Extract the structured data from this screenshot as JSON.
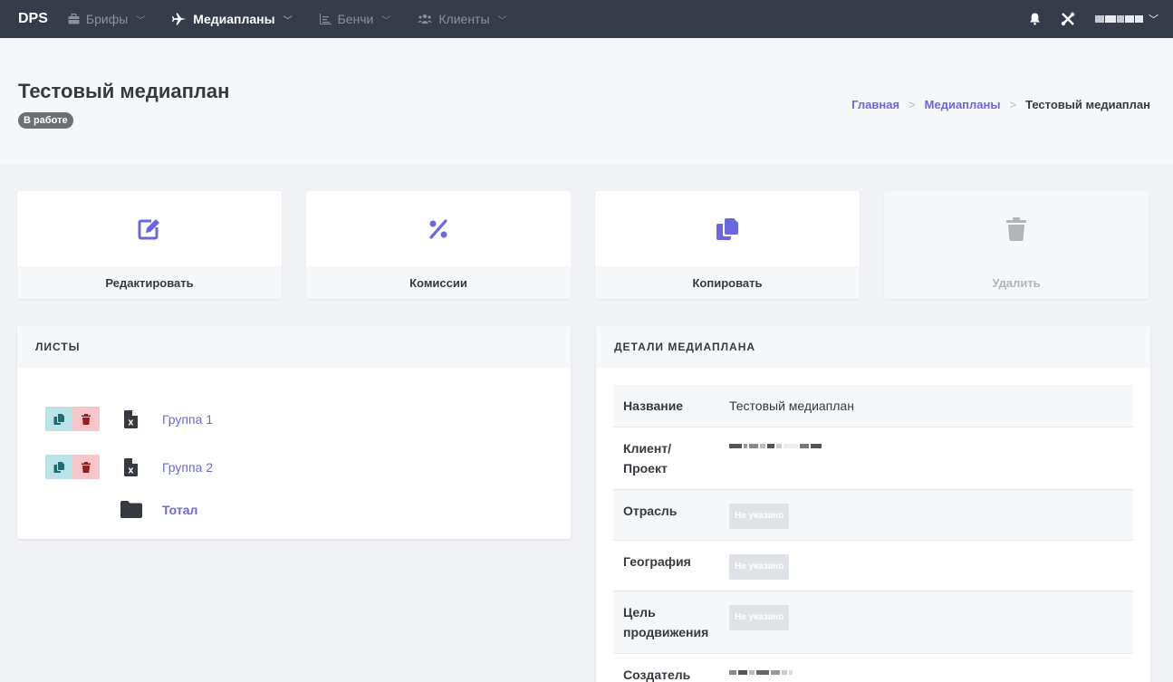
{
  "nav": {
    "brand": "DPS",
    "items": [
      {
        "label": "Брифы",
        "icon": "briefcase-icon",
        "active": false
      },
      {
        "label": "Медиапланы",
        "icon": "plane-icon",
        "active": true
      },
      {
        "label": "Бенчи",
        "icon": "chart-icon",
        "active": false
      },
      {
        "label": "Клиенты",
        "icon": "users-icon",
        "active": false
      }
    ]
  },
  "header": {
    "title": "Тестовый медиаплан",
    "status": "В работе",
    "breadcrumb": {
      "home": "Главная",
      "section": "Медиапланы",
      "current": "Тестовый медиаплан"
    }
  },
  "actions": {
    "edit": "Редактировать",
    "commissions": "Комиссии",
    "copy": "Копировать",
    "delete": "Удалить"
  },
  "sheets": {
    "title": "ЛИСТЫ",
    "items": [
      {
        "label": "Группа 1"
      },
      {
        "label": "Группа 2"
      }
    ],
    "total": "Тотал"
  },
  "details": {
    "title": "ДЕТАЛИ МЕДИАПЛАНА",
    "rows": [
      {
        "key": "Название",
        "value": "Тестовый медиаплан"
      },
      {
        "key": "Клиент/ Проект",
        "value": ""
      },
      {
        "key": "Отрасль",
        "value": "Не указано"
      },
      {
        "key": "География",
        "value": "Не указано"
      },
      {
        "key": "Цель продвижения",
        "value": "Не указано"
      },
      {
        "key": "Создатель",
        "value": ""
      }
    ]
  },
  "colors": {
    "accent": "#6b67e0",
    "nav_bg": "#363c49",
    "danger": "#9b1c1f",
    "copy_icon": "#1e6b70"
  }
}
